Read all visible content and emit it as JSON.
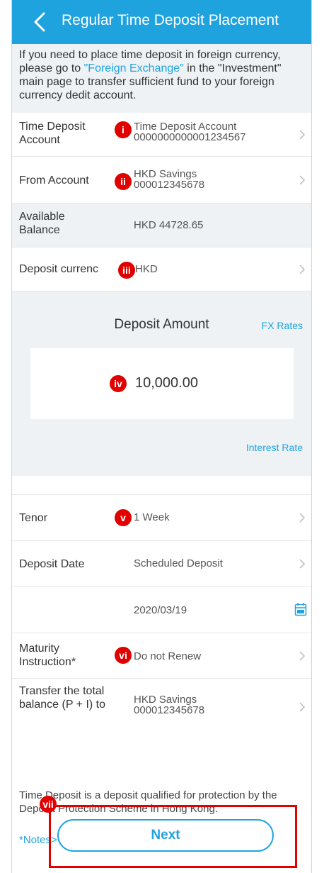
{
  "header": {
    "title": "Regular Time Deposit Placement",
    "back_icon": "chevron-left-icon"
  },
  "notice": {
    "part1": "If you need to place time deposit in foreign currency, please go to ",
    "link": "\"Foreign Exchange\"",
    "part2": " in the \"Investment\" main page to transfer sufficient fund to your foreign currency dedit account."
  },
  "rows": {
    "time_deposit_account": {
      "label": "Time Deposit Account",
      "value1": "Time Deposit Account",
      "value2": "0000000000001234567",
      "badge": "i"
    },
    "from_account": {
      "label": "From Account",
      "value1": "HKD  Savings",
      "value2": "000012345678",
      "badge": "ii"
    },
    "available_balance": {
      "label": "Available Balance",
      "value": "HKD 44728.65"
    },
    "deposit_currency": {
      "label": "Deposit currency",
      "label_visible": "Deposit currenc",
      "value": "HKD",
      "badge": "iii"
    }
  },
  "amount": {
    "title": "Deposit Amount",
    "fx_rates": "FX Rates",
    "value": "10,000.00",
    "interest_rate": "Interest Rate",
    "badge": "iv"
  },
  "lower_rows": {
    "tenor": {
      "label": "Tenor",
      "value": "1 Week",
      "badge": "v"
    },
    "deposit_date": {
      "label": "Deposit Date",
      "value": "Scheduled Deposit"
    },
    "date": {
      "value": "2020/03/19",
      "icon": "calendar-icon"
    },
    "maturity": {
      "label": "Maturity Instruction*",
      "value": "Do not Renew",
      "badge": "vi"
    },
    "transfer": {
      "label": "Transfer the total balance (P + I) to",
      "value1": "HKD Savings",
      "value2": "000012345678"
    }
  },
  "footer": {
    "note": "Time Deposit is a deposit qualified for protection by the Deposit Protection Scheme in Hong Kong.",
    "notes_link": "*Notes>",
    "next_label": "Next",
    "badge": "vii"
  },
  "colors": {
    "brand": "#1fa3de",
    "annotation_red": "#e00000",
    "grey_bg": "#eef2f5"
  }
}
